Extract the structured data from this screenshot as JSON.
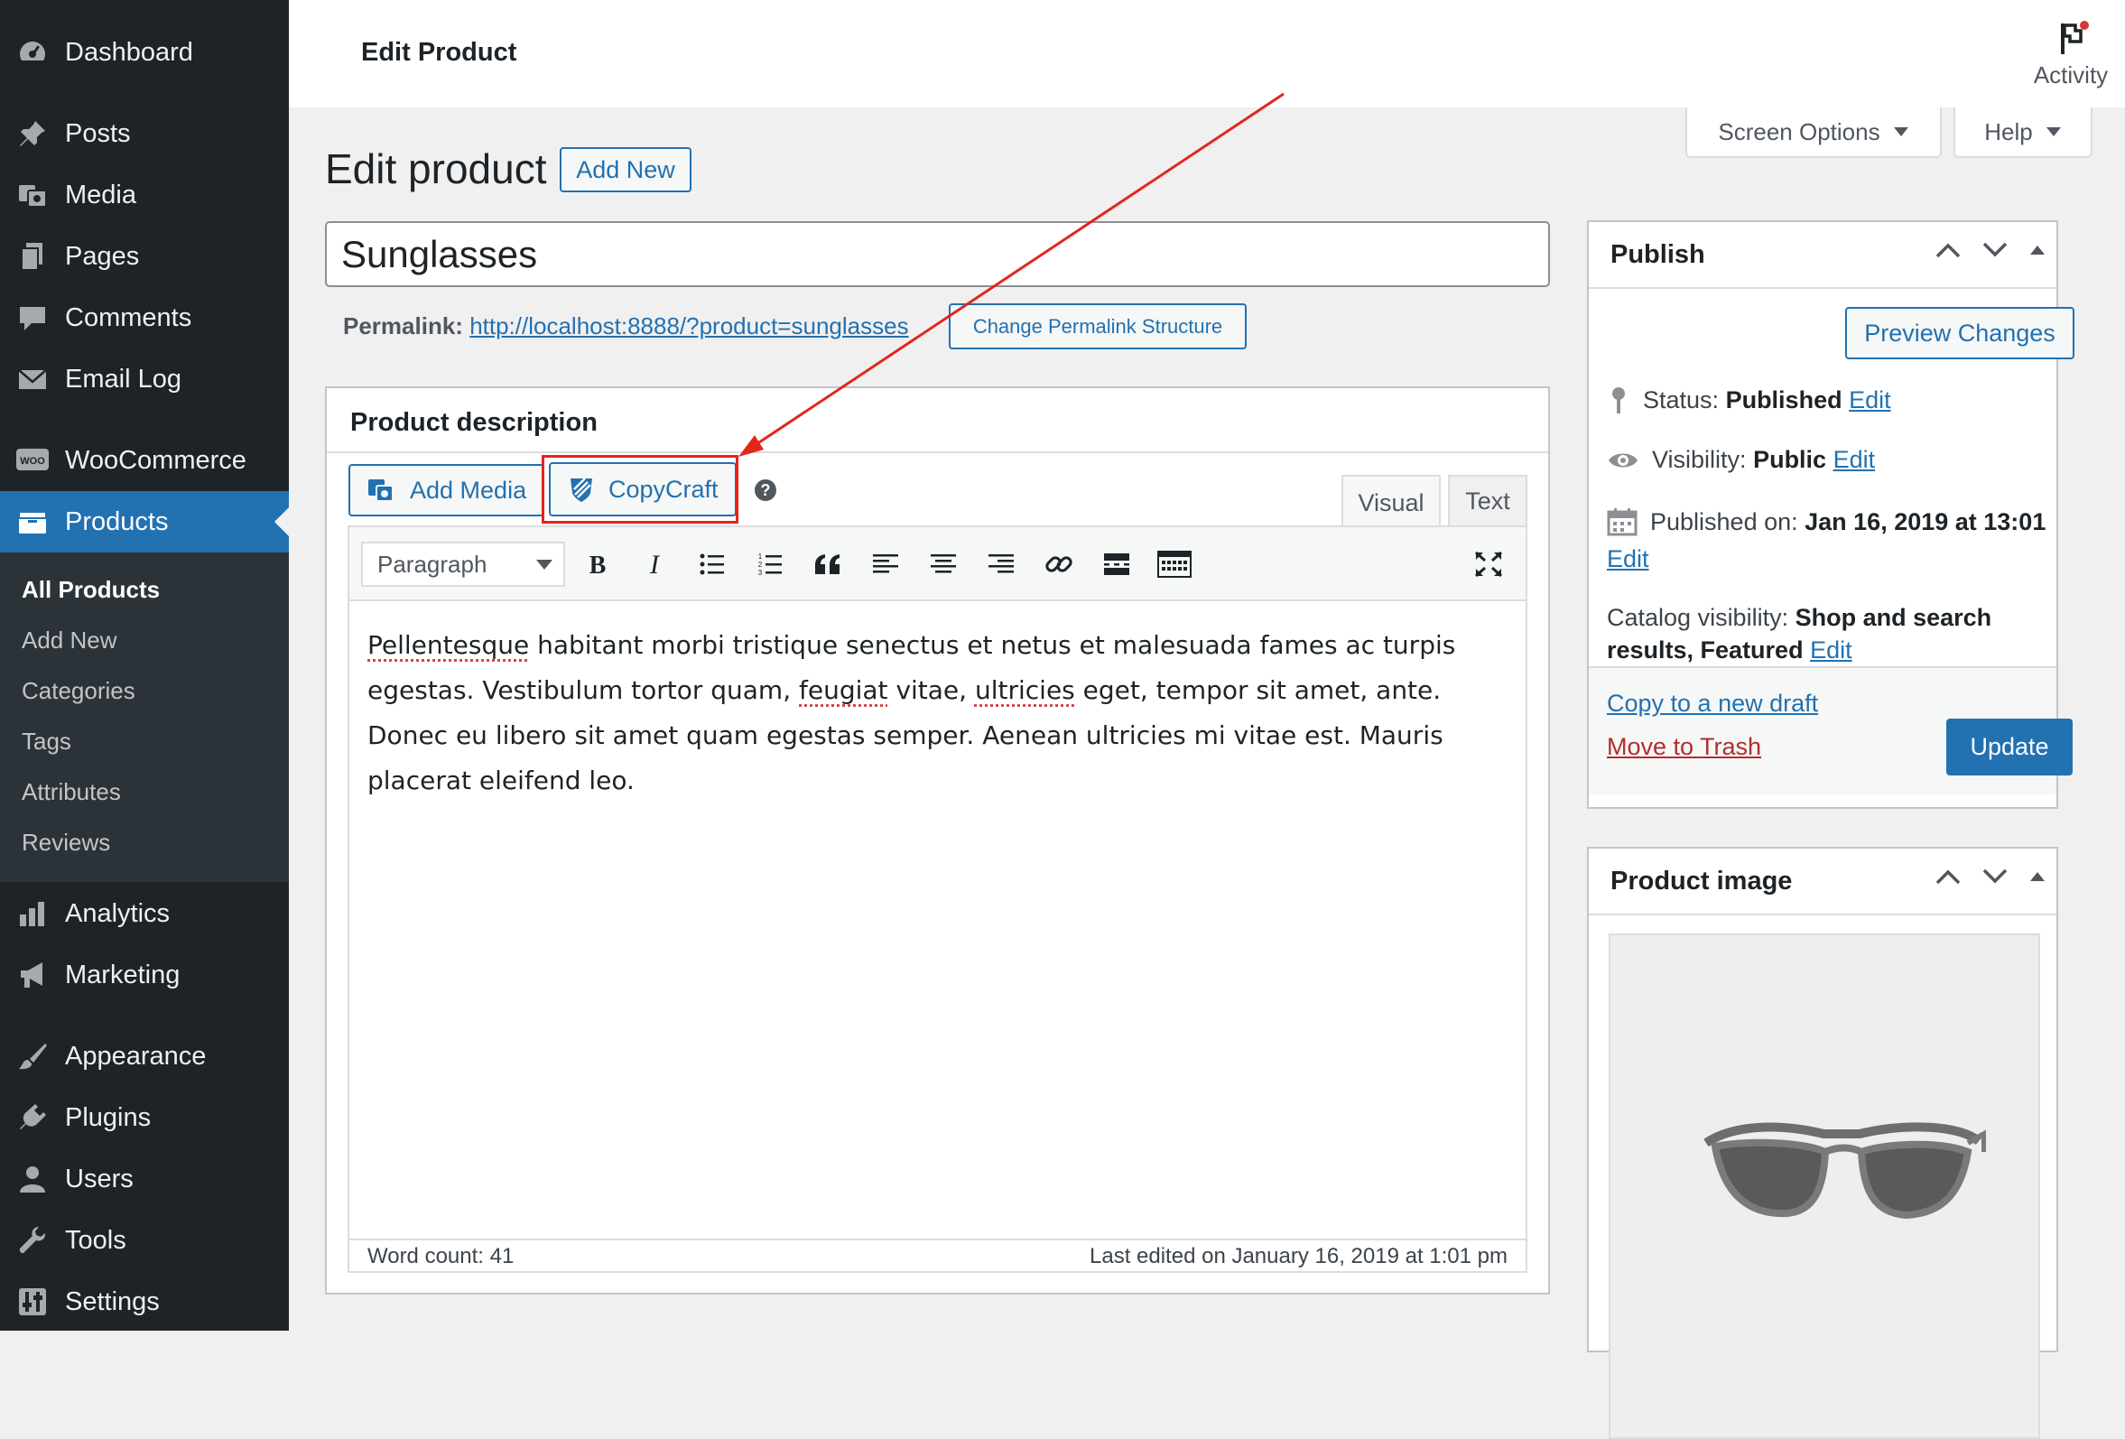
{
  "sidebar": {
    "items": [
      {
        "label": "Dashboard",
        "icon": "dashboard-icon"
      },
      {
        "label": "Posts",
        "icon": "pin-icon"
      },
      {
        "label": "Media",
        "icon": "media-icon"
      },
      {
        "label": "Pages",
        "icon": "pages-icon"
      },
      {
        "label": "Comments",
        "icon": "comment-icon"
      },
      {
        "label": "Email Log",
        "icon": "email-icon"
      },
      {
        "label": "WooCommerce",
        "icon": "woo-icon",
        "badge": "WOO"
      },
      {
        "label": "Products",
        "icon": "products-icon"
      },
      {
        "label": "Analytics",
        "icon": "analytics-icon"
      },
      {
        "label": "Marketing",
        "icon": "megaphone-icon"
      },
      {
        "label": "Appearance",
        "icon": "brush-icon"
      },
      {
        "label": "Plugins",
        "icon": "plugin-icon"
      },
      {
        "label": "Users",
        "icon": "user-icon"
      },
      {
        "label": "Tools",
        "icon": "wrench-icon"
      },
      {
        "label": "Settings",
        "icon": "settings-icon"
      }
    ],
    "submenu": [
      "All Products",
      "Add New",
      "Categories",
      "Tags",
      "Attributes",
      "Reviews"
    ]
  },
  "header": {
    "title": "Edit Product",
    "activity_label": "Activity"
  },
  "screen_tabs": {
    "screen_options": "Screen Options",
    "help": "Help"
  },
  "page": {
    "heading": "Edit product",
    "add_new": "Add New"
  },
  "title_field": {
    "value": "Sunglasses"
  },
  "permalink": {
    "label": "Permalink:",
    "url": "http://localhost:8888/?product=sunglasses",
    "change_button": "Change Permalink Structure"
  },
  "description": {
    "title": "Product description",
    "add_media": "Add Media",
    "copycraft": "CopyCraft",
    "help": "?",
    "tab_visual": "Visual",
    "tab_text": "Text",
    "format": "Paragraph",
    "content": {
      "w1": "Pellentesque",
      "t1": " habitant morbi tristique senectus et netus et malesuada fames ac turpis egestas. Vestibulum tortor quam, ",
      "w2": "feugiat",
      "t2": " vitae, ",
      "w3": "ultricies",
      "t3": " eget, tempor sit amet, ante. Donec eu libero sit amet quam egestas semper. Aenean ultricies mi vitae est. Mauris placerat eleifend leo."
    },
    "word_count": "Word count: 41",
    "last_edited": "Last edited on January 16, 2019 at 1:01 pm"
  },
  "publish": {
    "title": "Publish",
    "preview": "Preview Changes",
    "status_label": "Status:",
    "status_value": "Published",
    "visibility_label": "Visibility:",
    "visibility_value": "Public",
    "published_label": "Published on:",
    "published_value": "Jan 16, 2019 at 13:01",
    "catalog_label": "Catalog visibility:",
    "catalog_value_1": "Shop and search",
    "catalog_value_2": "results, Featured",
    "edit": "Edit",
    "copy_draft": "Copy to a new draft",
    "trash": "Move to Trash",
    "update": "Update"
  },
  "product_image": {
    "title": "Product image"
  },
  "colors": {
    "sidebar": "#1d2327",
    "accent": "#2271b1",
    "annotation": "#e4251b",
    "trash": "#b32d2e"
  }
}
